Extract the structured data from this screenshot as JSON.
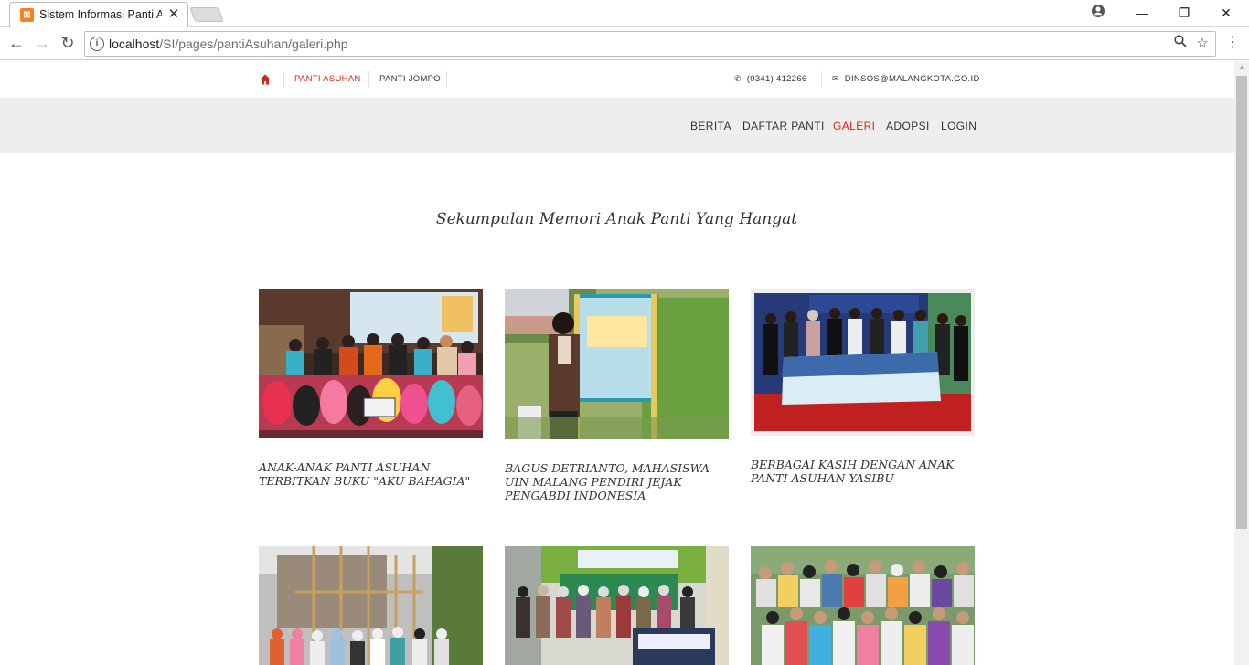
{
  "browser": {
    "tab_title": "Sistem Informasi Panti As",
    "tab_favicon": "xampp-icon",
    "url_host": "localhost",
    "url_path": "/SI/pages/pantiAsuhan/galeri.php"
  },
  "topbar": {
    "links": [
      "PANTI ASUHAN",
      "PANTI JOMPO"
    ],
    "phone": "(0341) 412266",
    "email": "DINSOS@MALANGKOTA.GO.ID"
  },
  "nav": {
    "items": [
      "BERITA",
      "DAFTAR PANTI",
      "GALERI",
      "ADOPSI",
      "LOGIN"
    ],
    "active_item": "GALERI",
    "accent_color": "#d0281c"
  },
  "headline": "Sekumpulan Memori Anak Panti Yang Hangat",
  "gallery": [
    {
      "caption": "ANAK-ANAK PANTI ASUHAN TERBITKAN BUKU \"AKU BAHAGIA\"",
      "photo": "group-book-launch-photo"
    },
    {
      "caption": "BAGUS DETRIANTO, MAHASISWA UIN MALANG PENDIRI JEJAK PENGABDI INDONESIA",
      "photo": "student-with-poster-photo"
    },
    {
      "caption": "BERBAGAI KASIH DENGAN ANAK PANTI ASUHAN YASIBU",
      "photo": "isra-miraj-banner-photo"
    },
    {
      "caption": "",
      "photo": "construction-group-photo"
    },
    {
      "caption": "",
      "photo": "orphanage-visit-photo"
    },
    {
      "caption": "",
      "photo": "children-crowd-photo"
    }
  ]
}
